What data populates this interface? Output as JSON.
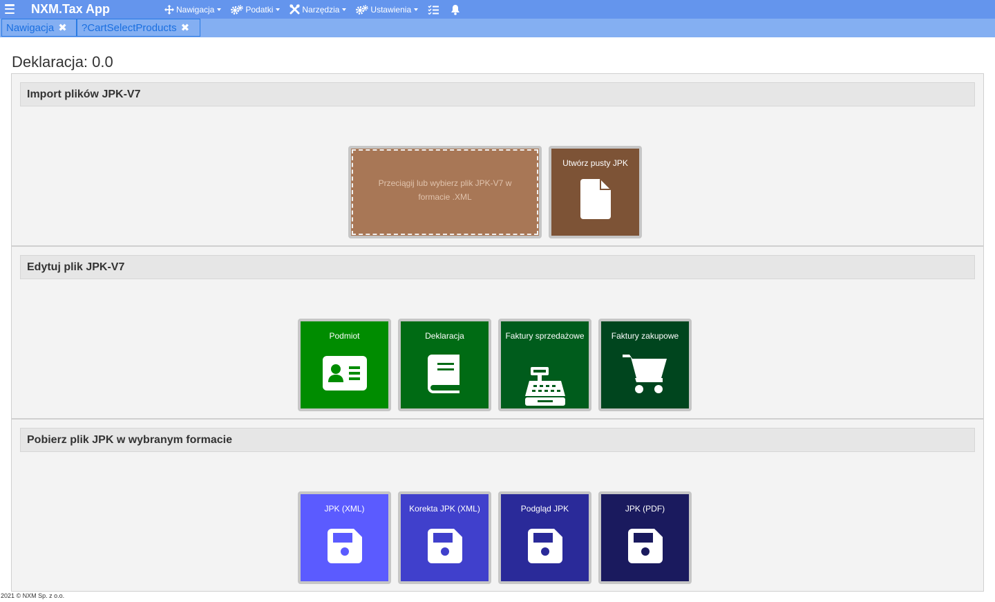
{
  "app": {
    "brand": "NXM.Tax App"
  },
  "menu": [
    {
      "label": "Nawigacja",
      "icon": "arrows-move-icon"
    },
    {
      "label": "Podatki",
      "icon": "gears-icon"
    },
    {
      "label": "Narzędzia",
      "icon": "tools-icon"
    },
    {
      "label": "Ustawienia",
      "icon": "gears-icon"
    }
  ],
  "tabs": [
    {
      "label": "Nawigacja"
    },
    {
      "label": "?CartSelectProducts"
    }
  ],
  "page": {
    "title": "Deklaracja: 0.0"
  },
  "sections": {
    "import": {
      "header": "Import plików JPK-V7",
      "dropzone_text": "Przeciągij lub wybierz plik JPK-V7 w formacie .XML",
      "create_empty": "Utwórz pusty JPK"
    },
    "edit": {
      "header": "Edytuj plik JPK-V7",
      "tiles": [
        {
          "label": "Podmiot",
          "icon": "id-card-icon",
          "color": "#008c00"
        },
        {
          "label": "Deklaracja",
          "icon": "book-icon",
          "color": "#006b14"
        },
        {
          "label": "Faktury sprzedażowe",
          "icon": "cash-register-icon",
          "color": "#005c1c"
        },
        {
          "label": "Faktury zakupowe",
          "icon": "cart-icon",
          "color": "#00451e"
        }
      ]
    },
    "download": {
      "header": "Pobierz plik JPK w wybranym formacie",
      "tiles": [
        {
          "label": "JPK (XML)",
          "icon": "floppy-disk-icon",
          "color": "#5b5bff"
        },
        {
          "label": "Korekta JPK (XML)",
          "icon": "floppy-disk-icon",
          "color": "#4040cc"
        },
        {
          "label": "Podgląd JPK",
          "icon": "floppy-disk-icon",
          "color": "#2a2a99"
        },
        {
          "label": "JPK (PDF)",
          "icon": "floppy-disk-icon",
          "color": "#1a1a5e"
        }
      ]
    }
  },
  "colors": {
    "topbar": "#6495ed",
    "tabbar": "#84aff2",
    "create_empty_tile": "#7d5336",
    "dropzone": "#a87756"
  },
  "footer": {
    "text": "2021 © NXM Sp. z o.o."
  }
}
